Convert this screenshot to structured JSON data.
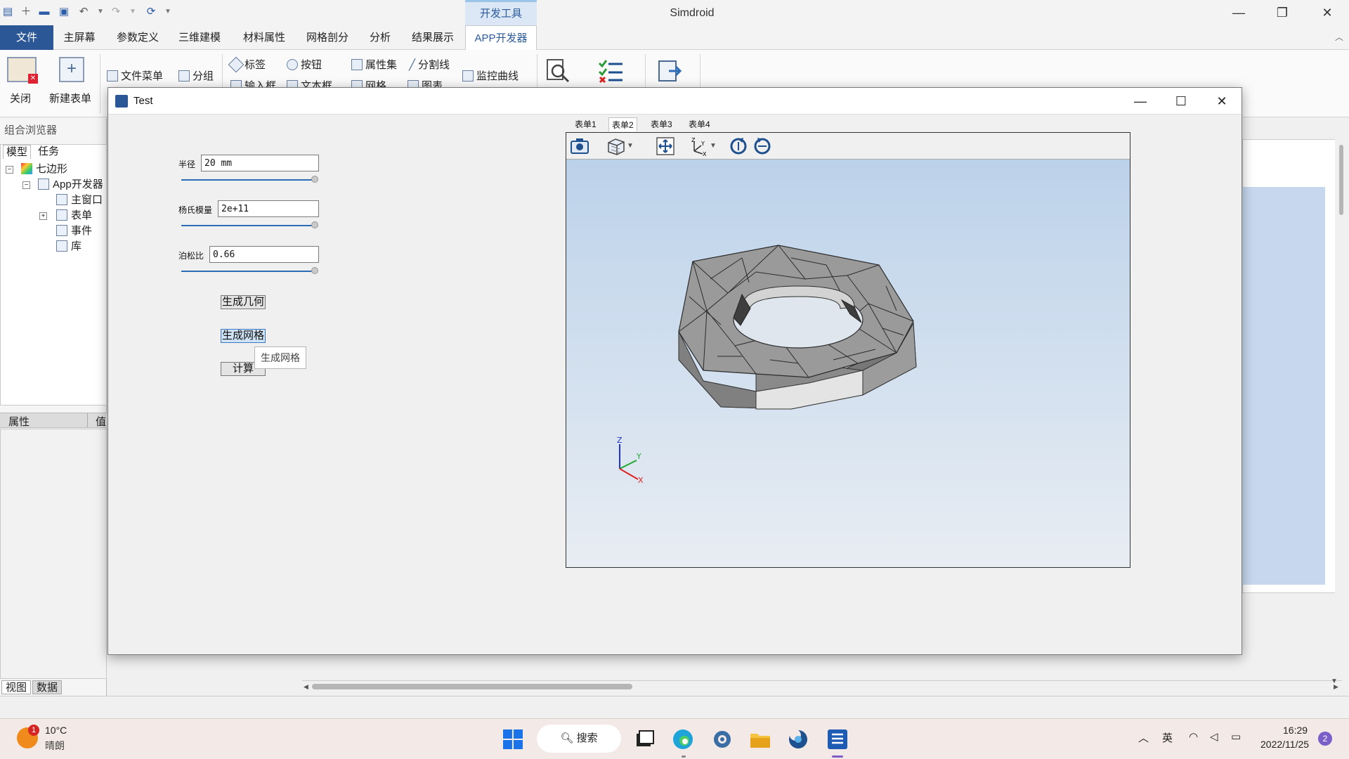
{
  "app": {
    "title": "Simdroid",
    "context_tab": "开发工具"
  },
  "menu": {
    "tabs": [
      "文件",
      "主屏幕",
      "参数定义",
      "三维建模",
      "材料属性",
      "网格剖分",
      "分析",
      "结果展示",
      "APP开发器"
    ]
  },
  "ribbon": {
    "close_label": "关闭",
    "new_form_label": "新建表单",
    "file_menu_label": "文件菜单",
    "group_label": "分组",
    "tag_label": "标签",
    "button_label": "按钮",
    "property_set_label": "属性集",
    "divider_label": "分割线",
    "monitor_curve_label": "监控曲线",
    "input_box_label": "输入框",
    "text_box_label": "文本框",
    "grid_label": "网格",
    "chart_label": "图表"
  },
  "left_panel": {
    "header": "组合浏览器",
    "tabs": [
      "模型",
      "任务"
    ],
    "tree": {
      "root": "七边形",
      "app": "App开发器",
      "main_window": "主窗口",
      "forms": "表单",
      "events": "事件",
      "library": "库"
    },
    "prop_cols": [
      "属性",
      "值"
    ],
    "bottom_tabs": [
      "视图",
      "数据"
    ]
  },
  "dialog": {
    "title": "Test",
    "fields": {
      "radius_label": "半径",
      "radius_value": "20 mm",
      "youngs_label": "杨氏模量",
      "youngs_value": "2e+11",
      "poisson_label": "泊松比",
      "poisson_value": "0.66"
    },
    "buttons": {
      "geometry": "生成几何",
      "mesh": "生成网格",
      "compute": "计算"
    },
    "tooltip": "生成网格",
    "form_tabs": [
      "表单1",
      "表单2",
      "表单3",
      "表单4"
    ],
    "axes": {
      "z": "Z",
      "y": "Y",
      "x": "X"
    }
  },
  "taskbar": {
    "weather_temp": "10°C",
    "weather_desc": "晴朗",
    "weather_badge": "1",
    "search_label": "搜索",
    "ime_label": "英",
    "time": "16:29",
    "date": "2022/11/25",
    "notification_count": "2"
  }
}
